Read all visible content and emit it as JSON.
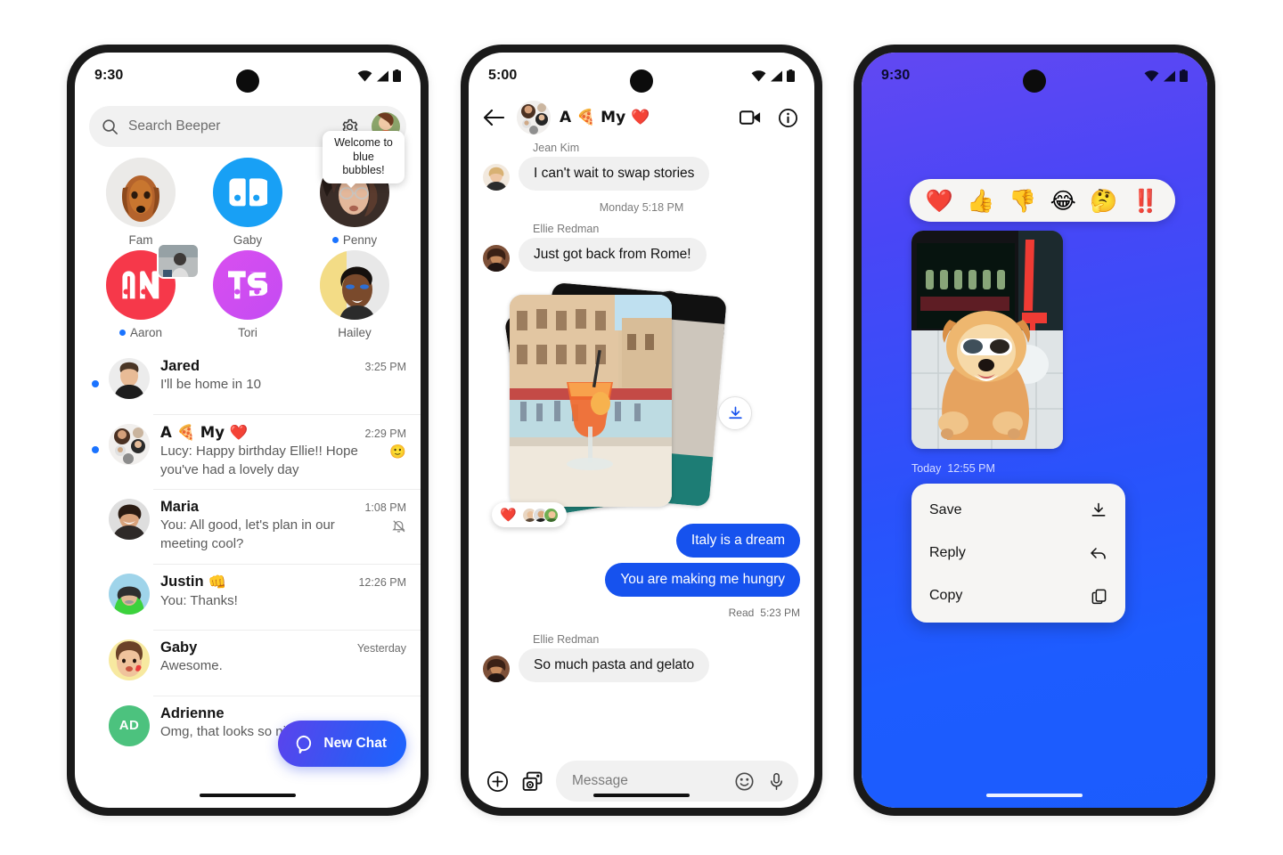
{
  "phone1": {
    "status": {
      "time": "9:30",
      "icons": [
        "wifi-icon",
        "signal-icon",
        "battery-icon"
      ]
    },
    "search": {
      "placeholder": "Search Beeper",
      "icon": "search-icon",
      "settings_icon": "gear-icon",
      "profile_icon": "profile-avatar"
    },
    "favorites": [
      {
        "name": "Fam",
        "type": "photo",
        "unread": false,
        "tooltip": ""
      },
      {
        "name": "Gaby",
        "type": "monogram",
        "initials": "GB",
        "color": "#18a0f5",
        "unread": false,
        "tooltip": ""
      },
      {
        "name": "Penny",
        "type": "photo",
        "unread": true,
        "tooltip": "Welcome to blue bubbles!"
      },
      {
        "name": "Aaron",
        "type": "monogram",
        "initials": "AN",
        "color": "#f6384a",
        "unread": true,
        "tooltip": ""
      },
      {
        "name": "Tori",
        "type": "monogram",
        "initials": "TS",
        "color": "#d84ff0",
        "unread": false,
        "tooltip": ""
      },
      {
        "name": "Hailey",
        "type": "photo",
        "unread": false,
        "tooltip": ""
      }
    ],
    "chats": [
      {
        "name": "Jared",
        "name_emoji": "",
        "time": "3:25 PM",
        "preview": "I'll be home in 10",
        "unread": true,
        "muted": false,
        "preview_emoji": ""
      },
      {
        "name": "A 🍕 My ❤️",
        "name_emoji": "",
        "time": "2:29 PM",
        "preview": "Lucy: Happy birthday Ellie!! Hope you've had a lovely day",
        "unread": true,
        "muted": false,
        "preview_emoji": "🙂"
      },
      {
        "name": "Maria",
        "name_emoji": "",
        "time": "1:08 PM",
        "preview": "You: All good, let's plan in our meeting cool?",
        "unread": false,
        "muted": true,
        "preview_emoji": ""
      },
      {
        "name": "Justin",
        "name_emoji": "👊",
        "time": "12:26 PM",
        "preview": "You: Thanks!",
        "unread": false,
        "muted": false,
        "preview_emoji": ""
      },
      {
        "name": "Gaby",
        "name_emoji": "",
        "time": "Yesterday",
        "preview": "Awesome.",
        "unread": false,
        "muted": false,
        "preview_emoji": ""
      },
      {
        "name": "Adrienne",
        "name_emoji": "",
        "time": "",
        "preview": "Omg, that looks so nice!",
        "unread": false,
        "muted": false,
        "preview_emoji": "",
        "initials": "AD",
        "avatar_color": "#4cc27e"
      }
    ],
    "fab": {
      "label": "New Chat",
      "icon": "chat-bubble-icon"
    }
  },
  "phone2": {
    "status": {
      "time": "5:00"
    },
    "header": {
      "back_icon": "back-arrow-icon",
      "title": "A 🍕 My ❤️",
      "video_icon": "video-call-icon",
      "info_icon": "info-icon"
    },
    "messages": [
      {
        "kind": "incoming",
        "sender": "Jean Kim",
        "text": "I can't wait to swap stories"
      },
      {
        "kind": "daystamp",
        "text": "Monday 5:18 PM"
      },
      {
        "kind": "incoming",
        "sender": "Ellie Redman",
        "text": "Just got back from Rome!"
      },
      {
        "kind": "photo-stack",
        "reaction": "❤️",
        "reactor_count": 3,
        "download_icon": "download-icon"
      },
      {
        "kind": "outgoing",
        "text": "Italy is a dream"
      },
      {
        "kind": "outgoing",
        "text": "You are making me hungry",
        "status": "Read",
        "time": "5:23 PM"
      },
      {
        "kind": "incoming",
        "sender": "Ellie Redman",
        "text": "So much pasta and gelato"
      }
    ],
    "composer": {
      "plus_icon": "plus-circle-icon",
      "gallery_icon": "photo-camera-icon",
      "placeholder": "Message",
      "emoji_icon": "emoji-smiley-icon",
      "mic_icon": "microphone-icon"
    }
  },
  "phone3": {
    "status": {
      "time": "9:30"
    },
    "reactions": [
      "❤️",
      "👍",
      "👎",
      "😂",
      "🤔",
      "‼️"
    ],
    "photo": {
      "timestamp_day": "Today",
      "timestamp_time": "12:55 PM"
    },
    "menu": [
      {
        "label": "Save",
        "icon": "download-icon"
      },
      {
        "label": "Reply",
        "icon": "reply-arrow-icon"
      },
      {
        "label": "Copy",
        "icon": "copy-icon"
      }
    ]
  },
  "colors": {
    "accent_blue": "#1652ee",
    "unread_dot": "#1a73ff",
    "fab_gradient_start": "#5b43ec",
    "fab_gradient_end": "#1b64ff",
    "bg_gradient_start": "#6248f2",
    "bg_gradient_end": "#1b5cfd"
  }
}
